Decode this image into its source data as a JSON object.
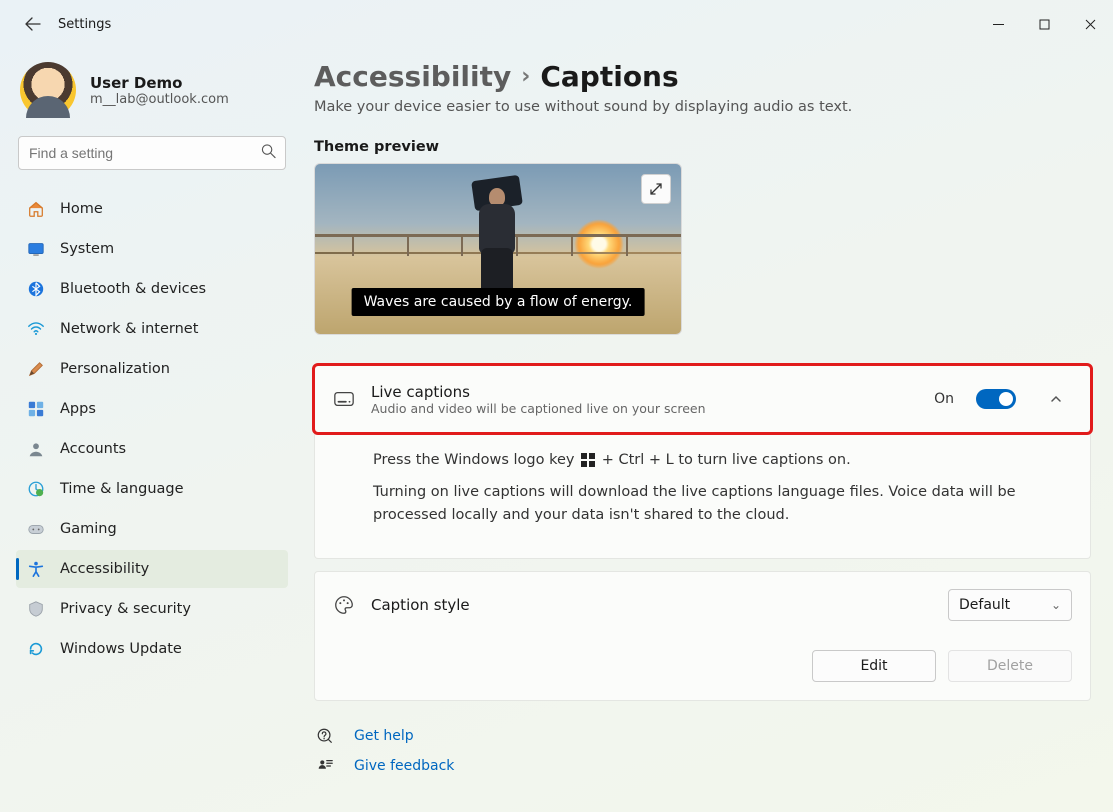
{
  "window": {
    "title": "Settings"
  },
  "user": {
    "name": "User Demo",
    "email": "m__lab@outlook.com"
  },
  "search": {
    "placeholder": "Find a setting"
  },
  "nav": {
    "items": [
      {
        "label": "Home"
      },
      {
        "label": "System"
      },
      {
        "label": "Bluetooth & devices"
      },
      {
        "label": "Network & internet"
      },
      {
        "label": "Personalization"
      },
      {
        "label": "Apps"
      },
      {
        "label": "Accounts"
      },
      {
        "label": "Time & language"
      },
      {
        "label": "Gaming"
      },
      {
        "label": "Accessibility"
      },
      {
        "label": "Privacy & security"
      },
      {
        "label": "Windows Update"
      }
    ]
  },
  "breadcrumb": {
    "parent": "Accessibility",
    "sep": "›",
    "current": "Captions"
  },
  "subtitle": "Make your device easier to use without sound by displaying audio as text.",
  "preview": {
    "section_label": "Theme preview",
    "caption_text": "Waves are caused by a flow of energy."
  },
  "live_captions": {
    "title": "Live captions",
    "subtitle": "Audio and video will be captioned live on your screen",
    "state_label": "On",
    "body_line1_pre": "Press the Windows logo key ",
    "body_line1_post": " + Ctrl + L to turn live captions on.",
    "body_line2": "Turning on live captions will download the live captions language files. Voice data will be processed locally and your data isn't shared to the cloud."
  },
  "caption_style": {
    "title": "Caption style",
    "selected": "Default",
    "edit_label": "Edit",
    "delete_label": "Delete"
  },
  "links": {
    "help": "Get help",
    "feedback": "Give feedback"
  }
}
